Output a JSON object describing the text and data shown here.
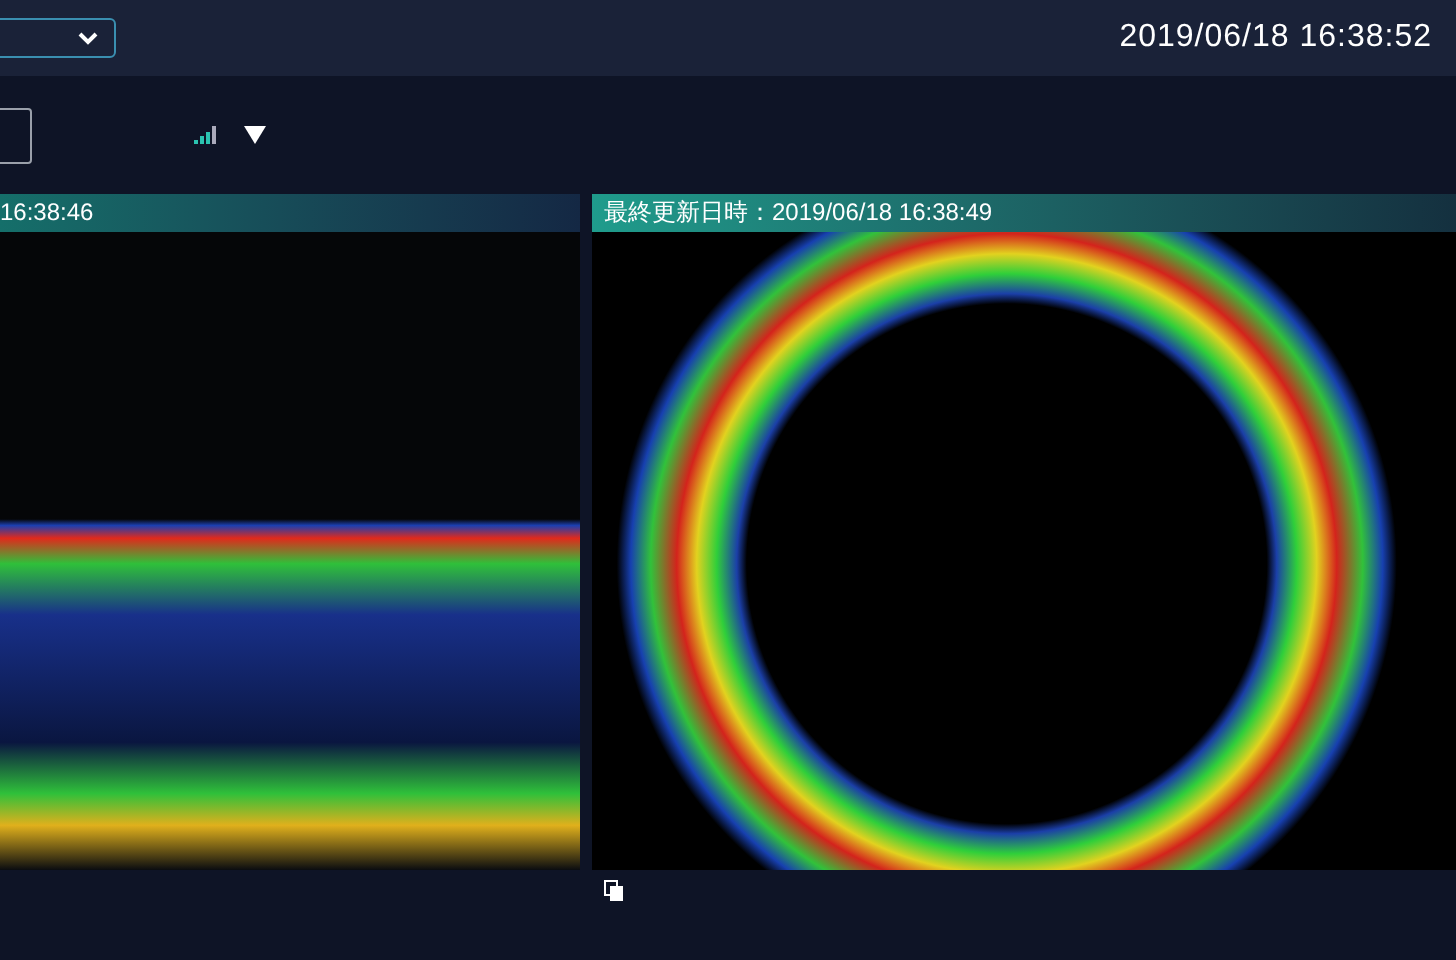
{
  "clock": "2019/06/18 16:38:52",
  "panels": [
    {
      "kind": "echogram",
      "timestamp": "16:38:46"
    },
    {
      "kind": "sonar",
      "timestamp": "最終更新日時：2019/06/18 16:38:49"
    }
  ]
}
